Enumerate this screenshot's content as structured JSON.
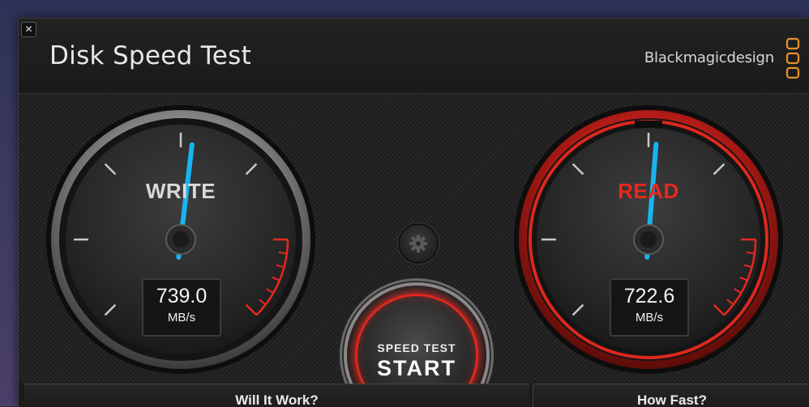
{
  "window": {
    "title": "Disk Speed Test",
    "brand": "Blackmagicdesign",
    "close_label": "✕"
  },
  "write_gauge": {
    "label": "WRITE",
    "value": "739.0",
    "unit": "MB/s",
    "label_color": "#d9d9d9",
    "needle_color": "#18b4f0"
  },
  "read_gauge": {
    "label": "READ",
    "value": "722.6",
    "unit": "MB/s",
    "label_color": "#e8281e",
    "needle_color": "#18b4f0"
  },
  "start_button": {
    "line1": "SPEED TEST",
    "line2": "START"
  },
  "tabs": {
    "will_it_work": "Will It Work?",
    "how_fast": "How Fast?"
  },
  "colors": {
    "accent_red": "#e8281e",
    "needle_blue": "#18b4f0",
    "brand_orange": "#e8912c"
  }
}
